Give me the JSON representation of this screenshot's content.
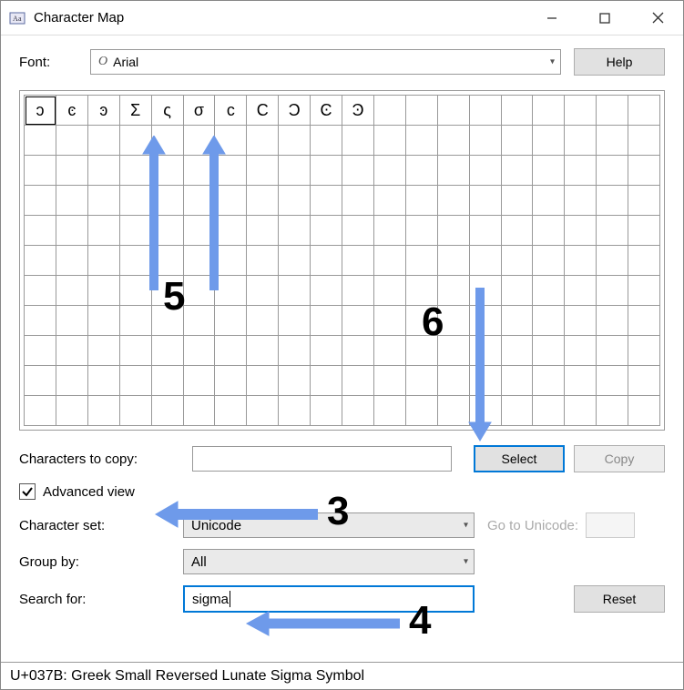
{
  "window": {
    "title": "Character Map"
  },
  "font_row": {
    "label": "Font:",
    "selected": "Arial",
    "help": "Help"
  },
  "grid": {
    "chars": [
      "ͻ",
      "ͼ",
      "ͽ",
      "Σ",
      "ς",
      "σ",
      "ϲ",
      "Ϲ",
      "Ͻ",
      "Ͼ",
      "Ͽ"
    ]
  },
  "copy_row": {
    "label": "Characters to copy:",
    "value": "",
    "select": "Select",
    "copy": "Copy"
  },
  "advanced": {
    "checkbox_label": "Advanced view",
    "checked": true
  },
  "charset_row": {
    "label": "Character set:",
    "value": "Unicode",
    "goto_label": "Go to Unicode:"
  },
  "group_row": {
    "label": "Group by:",
    "value": "All"
  },
  "search_row": {
    "label": "Search for:",
    "value": "sigma",
    "reset": "Reset"
  },
  "status": "U+037B: Greek Small Reversed Lunate Sigma Symbol",
  "annotations": {
    "n3": "3",
    "n4": "4",
    "n5": "5",
    "n6": "6"
  }
}
